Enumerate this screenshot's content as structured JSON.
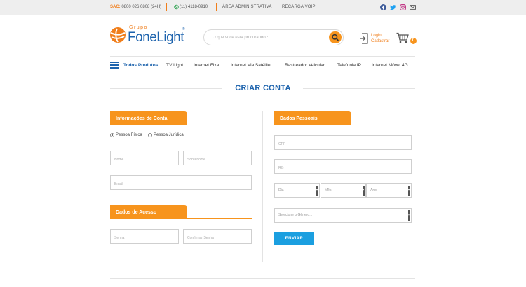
{
  "topbar": {
    "sac_label": "SAC:",
    "sac_number": "0800 026 0808 (24H)",
    "whatsapp_number": "(11) 4118-0910",
    "area_admin": "ÁREA ADMINISTRATIVA",
    "recarga_voip": "RECARGA VOIP",
    "social_icons": [
      "facebook-icon",
      "twitter-icon",
      "instagram-icon",
      "mail-icon"
    ]
  },
  "header": {
    "logo_group": "Grupo",
    "logo_brand": "FoneLight",
    "logo_reg": "®",
    "search_placeholder": "O que você está procurando?",
    "login_label": "Login",
    "register_label": "Cadastrar",
    "cart_count": "0"
  },
  "nav": {
    "items": [
      "Todos Produtos",
      "TV Light",
      "Internet Fixa",
      "Internet Via Satélite",
      "Rastreador Veicular",
      "Telefonia IP",
      "Internet Móvel 4G"
    ]
  },
  "page": {
    "title": "CRIAR CONTA"
  },
  "account_info": {
    "heading": "Informações de Conta",
    "person_type_options": [
      "Pessoa Física",
      "Pessoa Jurídica"
    ],
    "selected_person_type": "Pessoa Física",
    "first_name_placeholder": "Nome",
    "last_name_placeholder": "Sobrenome",
    "email_placeholder": "Email"
  },
  "access_data": {
    "heading": "Dados de Acesso",
    "password_placeholder": "Senha",
    "confirm_password_placeholder": "Confirmar Senha"
  },
  "personal_data": {
    "heading": "Dados Pessoais",
    "cpf_placeholder": "CPF",
    "rg_placeholder": "RG",
    "day_select": "Dia",
    "month_select": "Mês",
    "year_select": "Ano",
    "gender_select": "Selecione o Gênero...",
    "submit_label": "ENVIAR"
  },
  "colors": {
    "brand_blue": "#1d63ad",
    "brand_orange": "#f7941d",
    "submit_blue": "#1b9fe0"
  }
}
